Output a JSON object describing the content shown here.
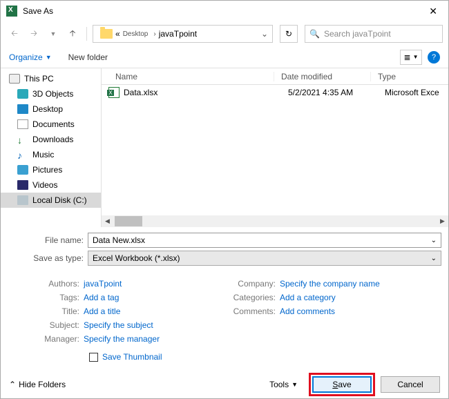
{
  "window": {
    "title": "Save As"
  },
  "breadcrumb": {
    "prefix": "«",
    "p1": "Desktop",
    "p2": "javaTpoint"
  },
  "search": {
    "placeholder": "Search javaTpoint"
  },
  "toolbar": {
    "organize": "Organize",
    "newfolder": "New folder"
  },
  "sidebar": {
    "pc": "This PC",
    "three_d": "3D Objects",
    "desktop": "Desktop",
    "documents": "Documents",
    "downloads": "Downloads",
    "music": "Music",
    "pictures": "Pictures",
    "videos": "Videos",
    "disk": "Local Disk (C:)"
  },
  "columns": {
    "name": "Name",
    "date": "Date modified",
    "type": "Type"
  },
  "files": [
    {
      "name": "Data.xlsx",
      "date": "5/2/2021 4:35 AM",
      "type": "Microsoft Exce"
    }
  ],
  "form": {
    "filename_label": "File name:",
    "filename_value": "Data New.xlsx",
    "type_label": "Save as type:",
    "type_value": "Excel Workbook (*.xlsx)"
  },
  "meta": {
    "authors_l": "Authors:",
    "authors_v": "javaTpoint",
    "tags_l": "Tags:",
    "tags_v": "Add a tag",
    "title_l": "Title:",
    "title_v": "Add a title",
    "subject_l": "Subject:",
    "subject_v": "Specify the subject",
    "manager_l": "Manager:",
    "manager_v": "Specify the manager",
    "company_l": "Company:",
    "company_v": "Specify the company name",
    "categories_l": "Categories:",
    "categories_v": "Add a category",
    "comments_l": "Comments:",
    "comments_v": "Add comments"
  },
  "thumb": "Save Thumbnail",
  "footer": {
    "hide": "Hide Folders",
    "tools": "Tools",
    "save": "Save",
    "cancel": "Cancel"
  }
}
